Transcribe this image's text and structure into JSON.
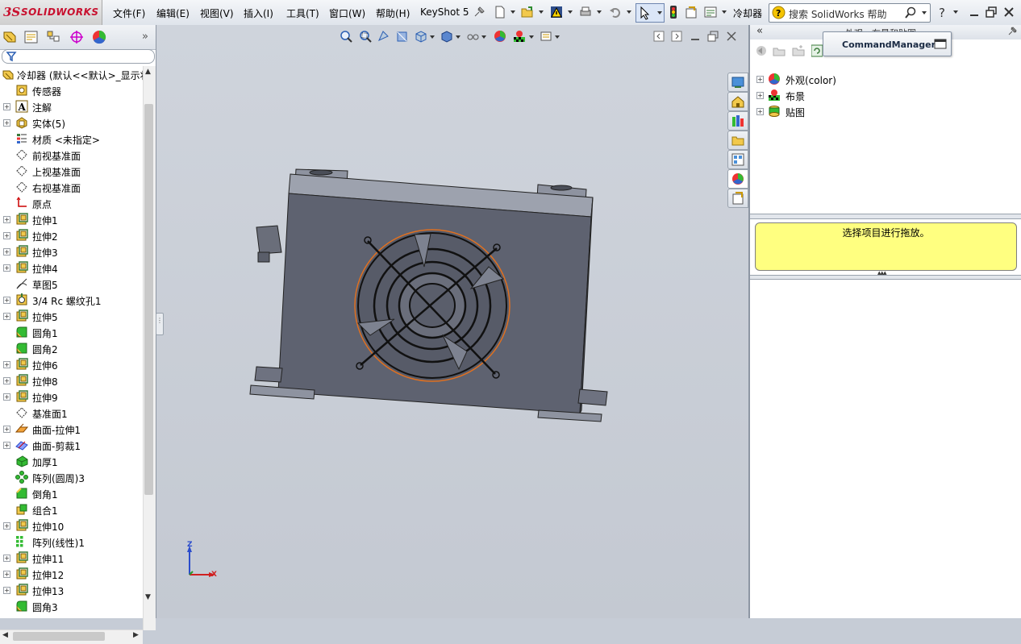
{
  "app": {
    "logo_ds": "3S",
    "logo_text": "SOLIDWORKS",
    "doc_title": "冷却器"
  },
  "menu": [
    "文件(F)",
    "编辑(E)",
    "视图(V)",
    "插入(I)",
    "工具(T)",
    "窗口(W)",
    "帮助(H)",
    "KeyShot 5"
  ],
  "search": {
    "placeholder": "搜索 SolidWorks 帮助"
  },
  "feature_tree": {
    "root": "冷却器 (默认<<默认>_显示状",
    "items": [
      {
        "label": "传感器",
        "icon": "sensor-icon",
        "expandable": false
      },
      {
        "label": "注解",
        "icon": "annotation-icon",
        "expandable": true
      },
      {
        "label": "实体(5)",
        "icon": "solid-bodies-icon",
        "expandable": true
      },
      {
        "label": "材质 <未指定>",
        "icon": "material-icon",
        "expandable": false
      },
      {
        "label": "前视基准面",
        "icon": "plane-icon",
        "expandable": false
      },
      {
        "label": "上视基准面",
        "icon": "plane-icon",
        "expandable": false
      },
      {
        "label": "右视基准面",
        "icon": "plane-icon",
        "expandable": false
      },
      {
        "label": "原点",
        "icon": "origin-icon",
        "expandable": false
      },
      {
        "label": "拉伸1",
        "icon": "extrude-icon",
        "expandable": true
      },
      {
        "label": "拉伸2",
        "icon": "extrude-icon",
        "expandable": true
      },
      {
        "label": "拉伸3",
        "icon": "extrude-icon",
        "expandable": true
      },
      {
        "label": "拉伸4",
        "icon": "extrude-icon",
        "expandable": true
      },
      {
        "label": "草图5",
        "icon": "sketch-icon",
        "expandable": false
      },
      {
        "label": "3/4 Rc 螺纹孔1",
        "icon": "hole-icon",
        "expandable": true
      },
      {
        "label": "拉伸5",
        "icon": "extrude-icon",
        "expandable": true
      },
      {
        "label": "圆角1",
        "icon": "fillet-icon",
        "expandable": false
      },
      {
        "label": "圆角2",
        "icon": "fillet-icon",
        "expandable": false
      },
      {
        "label": "拉伸6",
        "icon": "extrude-icon",
        "expandable": true
      },
      {
        "label": "拉伸8",
        "icon": "extrude-icon",
        "expandable": true
      },
      {
        "label": "拉伸9",
        "icon": "extrude-icon",
        "expandable": true
      },
      {
        "label": "基准面1",
        "icon": "plane-icon",
        "expandable": false
      },
      {
        "label": "曲面-拉伸1",
        "icon": "surface-extrude-icon",
        "expandable": true
      },
      {
        "label": "曲面-剪裁1",
        "icon": "surface-trim-icon",
        "expandable": true
      },
      {
        "label": "加厚1",
        "icon": "thicken-icon",
        "expandable": false
      },
      {
        "label": "阵列(圆周)3",
        "icon": "circular-pattern-icon",
        "expandable": false
      },
      {
        "label": "倒角1",
        "icon": "chamfer-icon",
        "expandable": false
      },
      {
        "label": "组合1",
        "icon": "combine-icon",
        "expandable": false
      },
      {
        "label": "拉伸10",
        "icon": "extrude-icon",
        "expandable": true
      },
      {
        "label": "阵列(线性)1",
        "icon": "linear-pattern-icon",
        "expandable": false
      },
      {
        "label": "拉伸11",
        "icon": "extrude-icon",
        "expandable": true
      },
      {
        "label": "拉伸12",
        "icon": "extrude-icon",
        "expandable": true
      },
      {
        "label": "拉伸13",
        "icon": "extrude-icon",
        "expandable": true
      },
      {
        "label": "圆角3",
        "icon": "fillet-icon",
        "expandable": false
      }
    ]
  },
  "right_panel": {
    "title": "外观、布景和贴图",
    "command_manager": "CommandManager",
    "items": [
      {
        "label": "外观(color)",
        "icon": "appearance-icon"
      },
      {
        "label": "布景",
        "icon": "scene-icon"
      },
      {
        "label": "贴图",
        "icon": "decal-icon"
      }
    ],
    "hint": "选择项目进行拖放。"
  },
  "triad": {
    "z": "Z",
    "x": "X"
  },
  "colors": {
    "accent": "#c8102e",
    "hint_bg": "#ffff80",
    "viewport": "#c6ccd6",
    "model": "#5e6270"
  }
}
